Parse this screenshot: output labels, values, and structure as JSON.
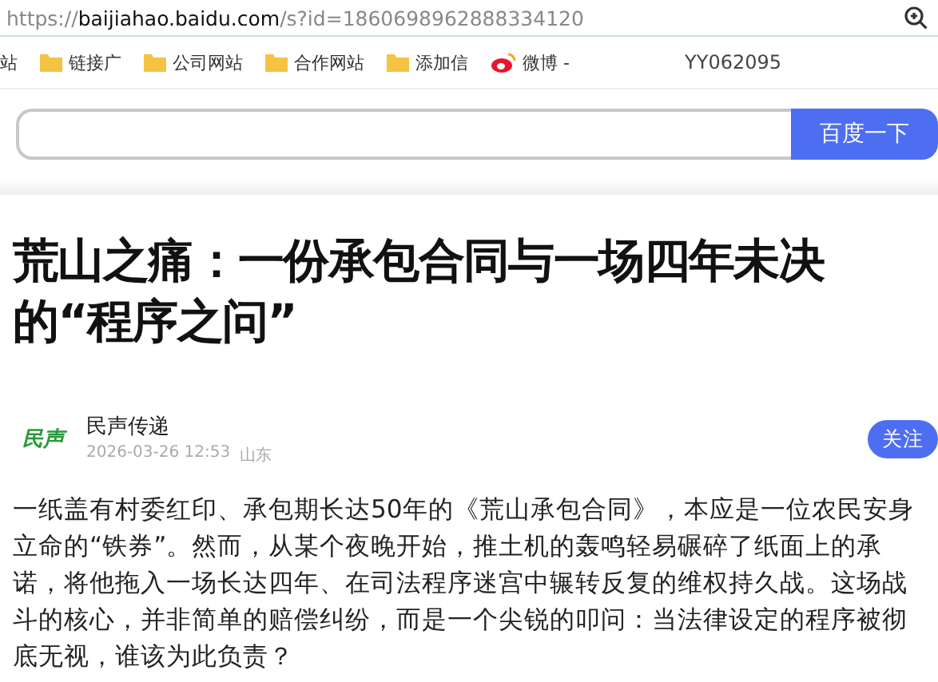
{
  "address_bar": {
    "url_prefix": "https://",
    "url_host": "baijiahao.baidu.com",
    "url_path": "/s?id=1860698962888334120"
  },
  "bookmarks": [
    {
      "label": "站",
      "kind": "text"
    },
    {
      "label": "链接广",
      "kind": "folder"
    },
    {
      "label": "公司网站",
      "kind": "folder"
    },
    {
      "label": "合作网站",
      "kind": "folder"
    },
    {
      "label": "添加信",
      "kind": "folder"
    },
    {
      "label": "微博 -",
      "kind": "weibo"
    }
  ],
  "watermark_id": "YY062095",
  "search": {
    "button": "百度一下"
  },
  "article": {
    "title": "荒山之痛：一份承包合同与一场四年未决的“程序之问”",
    "author": {
      "logo_text": "民声",
      "name": "民声传递",
      "date": "2026-03-26 12:53",
      "location": "山东",
      "follow": "关注"
    },
    "body": "一纸盖有村委红印、承包期长达50年的《荒山承包合同》，本应是一位农民安身立命的“铁券”。然而，从某个夜晚开始，推土机的轰鸣轻易碾碎了纸面上的承诺，将他拖入一场长达四年、在司法程序迷宫中辗转反复的维权持久战。这场战斗的核心，并非简单的赔偿纠纷，而是一个尖锐的叩问：当法律设定的程序被彻底无视，谁该为此负责？"
  }
}
